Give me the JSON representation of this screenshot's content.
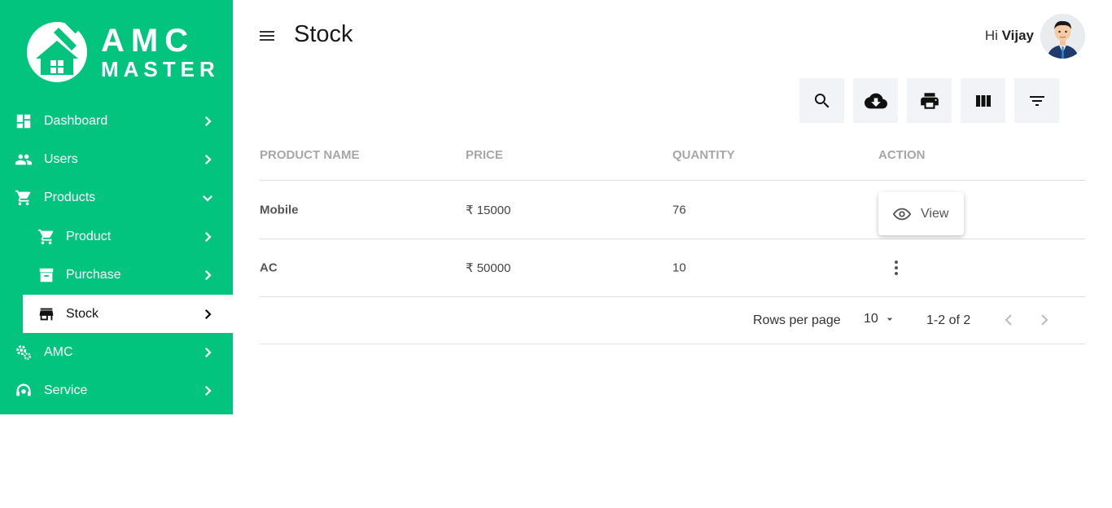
{
  "brand": {
    "line1": "AMC",
    "line2": "MASTER"
  },
  "sidebar": {
    "items": [
      {
        "label": "Dashboard",
        "icon": "dashboard-icon"
      },
      {
        "label": "Users",
        "icon": "users-icon"
      },
      {
        "label": "Products",
        "icon": "cart-icon",
        "expanded": true
      },
      {
        "label": "Product",
        "icon": "cart-icon",
        "sub": true
      },
      {
        "label": "Purchase",
        "icon": "archive-icon",
        "sub": true
      },
      {
        "label": "Stock",
        "icon": "store-icon",
        "sub": true,
        "active": true
      },
      {
        "label": "AMC",
        "icon": "gears-icon"
      },
      {
        "label": "Service",
        "icon": "headset-icon"
      }
    ]
  },
  "header": {
    "title": "Stock",
    "greeting_prefix": "Hi",
    "user_name": "Vijay"
  },
  "toolbar": {
    "icons": [
      "search-icon",
      "cloud-download-icon",
      "print-icon",
      "columns-icon",
      "filter-icon"
    ]
  },
  "table": {
    "columns": [
      "PRODUCT NAME",
      "PRICE",
      "QUANTITY",
      "ACTION"
    ],
    "rows": [
      {
        "name": "Mobile",
        "price": "₹ 15000",
        "quantity": "76"
      },
      {
        "name": "AC",
        "price": "₹ 50000",
        "quantity": "10"
      }
    ],
    "action_menu_label": "View"
  },
  "pagination": {
    "rows_per_page_label": "Rows per page",
    "rows_per_page": "10",
    "range": "1-2 of 2"
  },
  "colors": {
    "sidebar": "#03c47e",
    "toolbar_bg": "#f1f3f6"
  }
}
